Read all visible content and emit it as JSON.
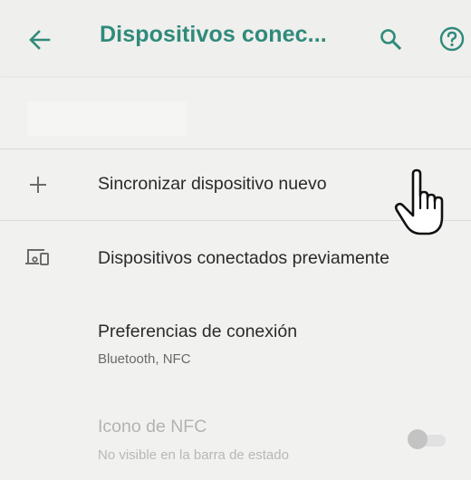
{
  "appbar": {
    "title": "Dispositivos conec...",
    "back_icon": "arrow-left-icon",
    "search_icon": "search-icon",
    "help_icon": "help-circle-icon"
  },
  "rows": {
    "pair_new": {
      "icon": "plus-icon",
      "title": "Sincronizar dispositivo nuevo"
    },
    "previous": {
      "icon": "devices-icon",
      "title": "Dispositivos conectados previamente"
    },
    "preferences": {
      "title": "Preferencias de conexión",
      "subtitle": "Bluetooth, NFC"
    },
    "nfc_icon": {
      "title": "Icono de NFC",
      "subtitle": "No visible en la barra de estado",
      "enabled": false,
      "toggle_on": false
    }
  },
  "colors": {
    "accent": "#2f8a7a",
    "background": "#f1f1f0",
    "divider": "#d9d9d7",
    "text_primary": "#2a2a2a",
    "text_secondary": "#6a6a6a",
    "text_disabled": "#b3b3b3"
  },
  "cursor": {
    "icon": "hand-pointer-icon"
  }
}
